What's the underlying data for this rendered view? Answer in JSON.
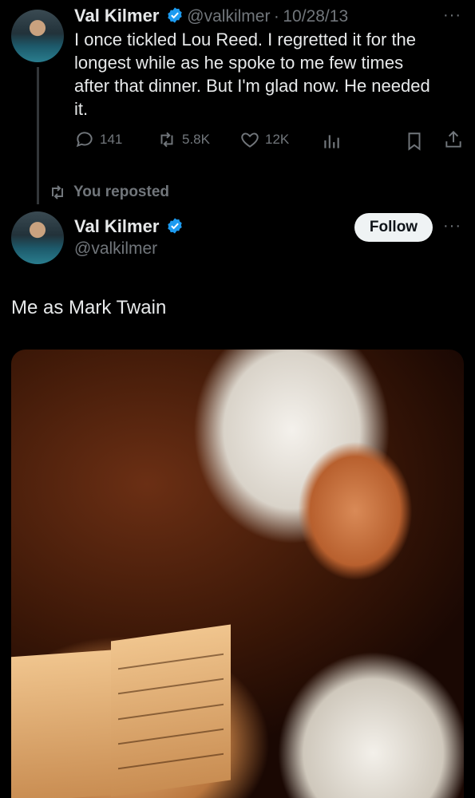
{
  "tweet1": {
    "author_name": "Val Kilmer",
    "handle": "@valkilmer",
    "separator": "·",
    "date": "10/28/13",
    "text_lines": [
      "I once tickled Lou Reed. I regretted it for the",
      "longest while as he spoke to me few times",
      "after that dinner. But I'm glad now. He needed",
      "it."
    ],
    "replies": "141",
    "reposts": "5.8K",
    "likes": "12K",
    "more": "···"
  },
  "repost_label": "You reposted",
  "tweet2": {
    "author_name": "Val Kilmer",
    "handle": "@valkilmer",
    "follow_label": "Follow",
    "more": "···",
    "text": "Me as Mark Twain"
  },
  "colors": {
    "background": "#000000",
    "text": "#e7e9ea",
    "muted": "#71767b",
    "verified": "#1d9bf0",
    "follow_bg": "#eff3f4"
  },
  "icons": [
    "reply-icon",
    "repost-icon",
    "like-icon",
    "views-icon",
    "bookmark-icon",
    "share-icon",
    "verified-badge-icon",
    "more-icon"
  ]
}
